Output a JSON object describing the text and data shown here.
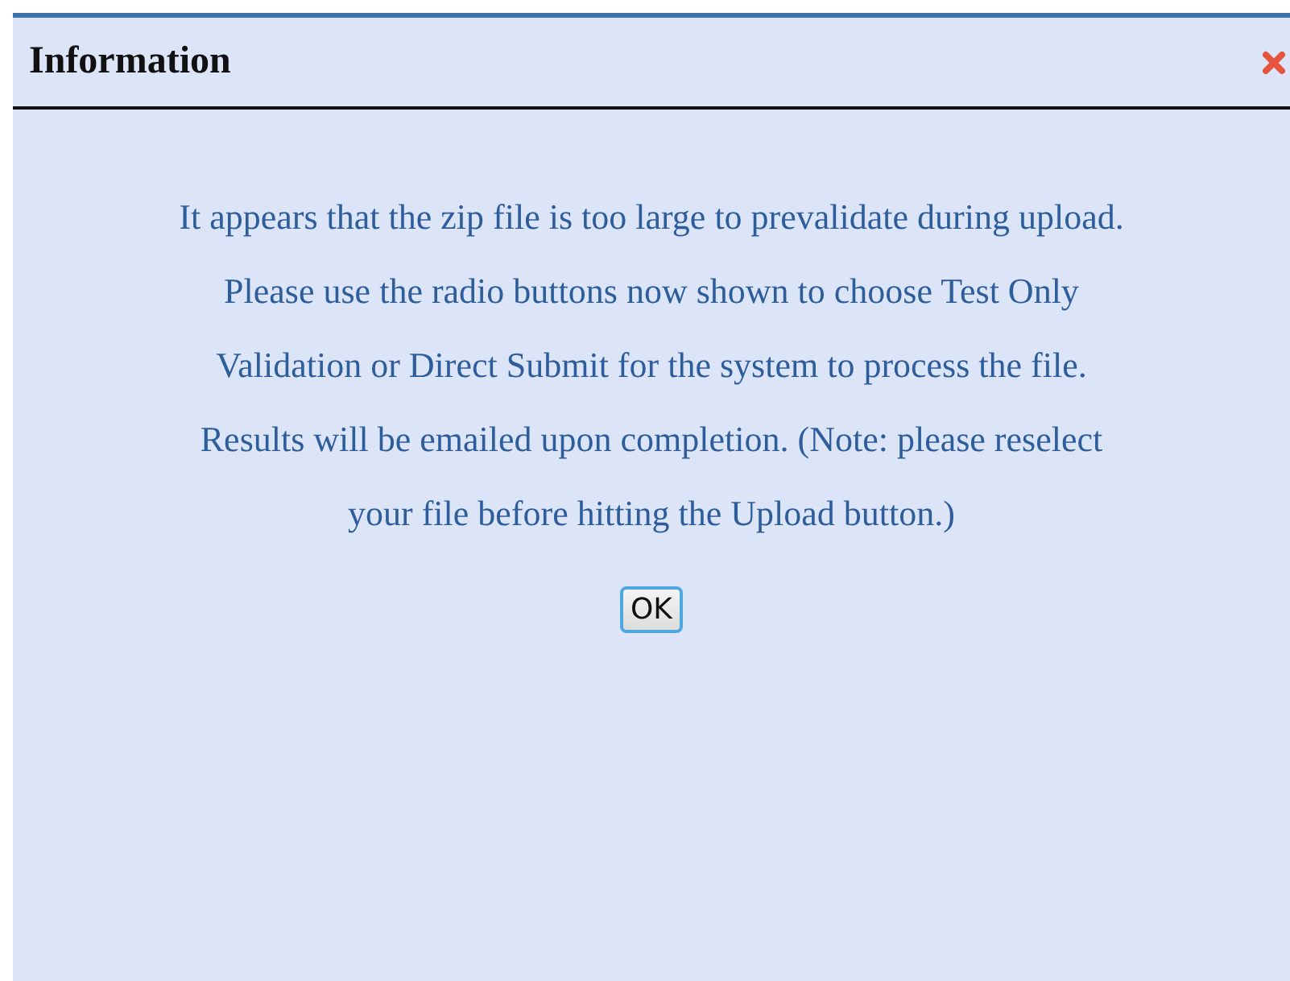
{
  "dialog": {
    "title": "Information",
    "message": "It appears that the zip file is too large to prevalidate during upload. Please use the radio buttons now shown to choose Test Only Validation or Direct Submit for the system to process the file. Results will be emailed upon completion. (Note: please reselect your file before hitting the Upload button.)",
    "buttons": [
      "OK"
    ]
  }
}
